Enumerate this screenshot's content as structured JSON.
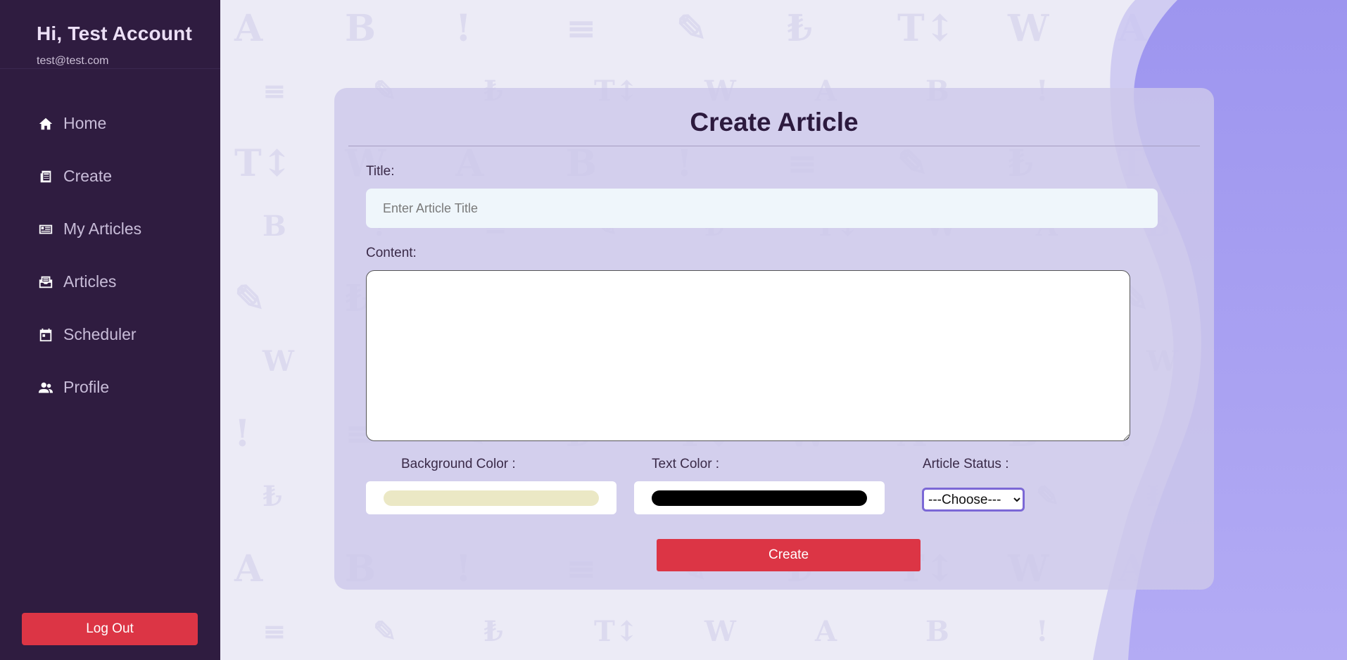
{
  "sidebar": {
    "greeting": "Hi, Test Account",
    "email": "test@test.com",
    "items": [
      {
        "label": "Home",
        "icon": "home-icon"
      },
      {
        "label": "Create",
        "icon": "newspaper-icon"
      },
      {
        "label": "My Articles",
        "icon": "article-list-icon"
      },
      {
        "label": "Articles",
        "icon": "inbox-icon"
      },
      {
        "label": "Scheduler",
        "icon": "calendar-icon"
      },
      {
        "label": "Profile",
        "icon": "users-icon"
      }
    ],
    "logout_label": "Log Out"
  },
  "form": {
    "title": "Create Article",
    "title_label": "Title:",
    "title_placeholder": "Enter Article Title",
    "title_value": "",
    "content_label": "Content:",
    "content_value": "",
    "bg_color_label": "Background Color :",
    "bg_color_value": "#ebe8c5",
    "text_color_label": "Text Color :",
    "text_color_value": "#000000",
    "status_label": "Article Status :",
    "status_selected": "---Choose---",
    "submit_label": "Create"
  },
  "colors": {
    "sidebar_bg": "#2f1c40",
    "accent_red": "#dc3545",
    "blob_purple": "#a49cf0",
    "card_bg": "#d1ccea"
  }
}
